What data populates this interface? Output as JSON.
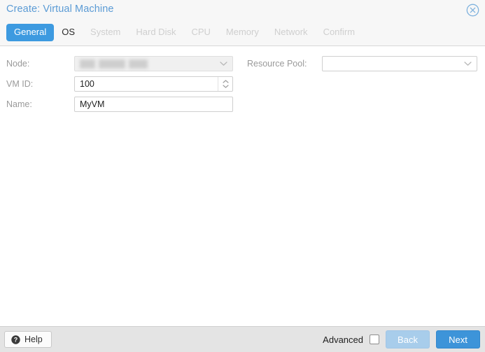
{
  "window": {
    "title": "Create: Virtual Machine",
    "close_icon": "close-circle-icon"
  },
  "tabs": [
    {
      "label": "General",
      "state": "active"
    },
    {
      "label": "OS",
      "state": "enabled"
    },
    {
      "label": "System",
      "state": "disabled"
    },
    {
      "label": "Hard Disk",
      "state": "disabled"
    },
    {
      "label": "CPU",
      "state": "disabled"
    },
    {
      "label": "Memory",
      "state": "disabled"
    },
    {
      "label": "Network",
      "state": "disabled"
    },
    {
      "label": "Confirm",
      "state": "disabled"
    }
  ],
  "form": {
    "node": {
      "label": "Node:",
      "value": "",
      "redacted": true,
      "disabled": true,
      "icon": "chevron-down-icon"
    },
    "vmid": {
      "label": "VM ID:",
      "value": "100",
      "icon": "spinner-updown-icon"
    },
    "name": {
      "label": "Name:",
      "value": "MyVM"
    },
    "resource_pool": {
      "label": "Resource Pool:",
      "value": "",
      "placeholder": "",
      "icon": "chevron-down-icon"
    }
  },
  "footer": {
    "help_label": "Help",
    "help_icon": "question-circle-icon",
    "advanced_label": "Advanced",
    "advanced_checked": false,
    "back_label": "Back",
    "back_disabled": true,
    "next_label": "Next"
  },
  "colors": {
    "accent": "#3d9ae0",
    "title": "#5b9bd5",
    "header_bg": "#f7f7f7",
    "footer_bg": "#e4e4e4",
    "disabled_text": "#cfcfcf",
    "label_text": "#9a9a9a"
  }
}
